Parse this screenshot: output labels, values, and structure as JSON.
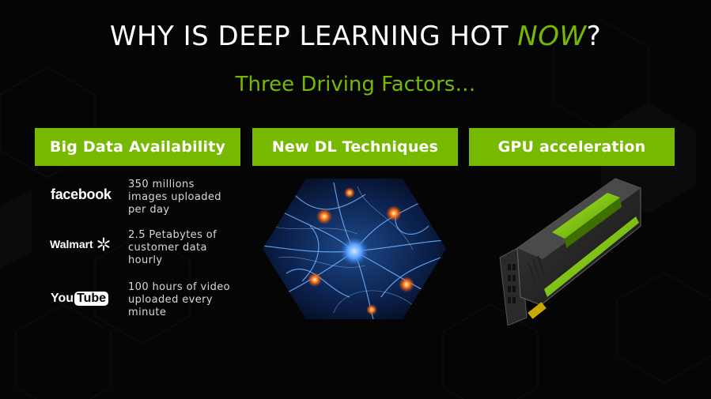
{
  "slide": {
    "title_prefix": "WHY IS DEEP LEARNING HOT ",
    "title_accent": "NOW",
    "title_suffix": "?",
    "subtitle": "Three Driving Factors…"
  },
  "factors": [
    {
      "label": "Big Data Availability"
    },
    {
      "label": "New DL Techniques"
    },
    {
      "label": "GPU acceleration"
    }
  ],
  "stats": [
    {
      "logo": "facebook",
      "text_lines": [
        "350 millions",
        "images uploaded",
        "per day"
      ]
    },
    {
      "logo": "Walmart",
      "text_lines": [
        "2.5 Petabytes of",
        "customer data",
        "hourly"
      ]
    },
    {
      "logo_you": "You",
      "logo_tube": "Tube",
      "text_lines": [
        "100 hours of video",
        "uploaded every",
        "minute"
      ]
    }
  ],
  "colors": {
    "accent": "#76b900",
    "background": "#050505"
  },
  "icons": {
    "walmart_spark": "walmart-spark-icon",
    "neuron_image": "neuron-network-image",
    "gpu_image": "gpu-card-image"
  }
}
